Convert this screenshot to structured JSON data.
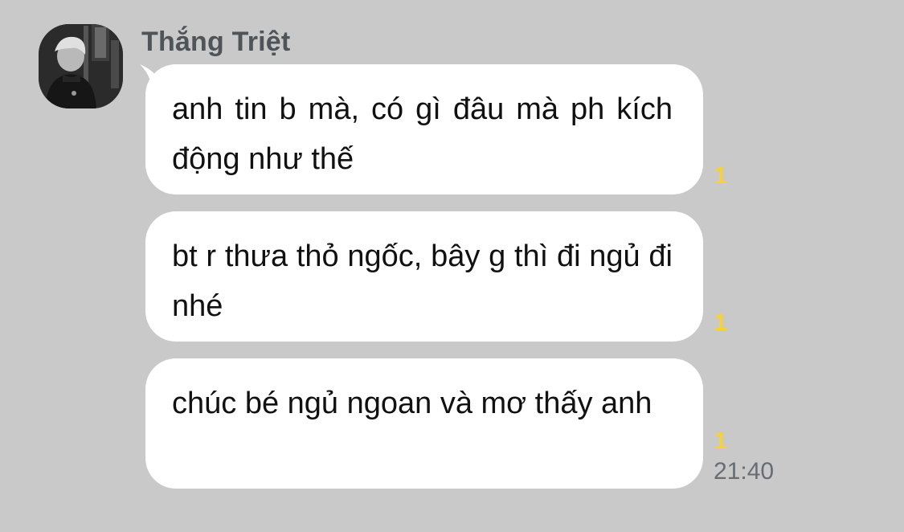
{
  "chat": {
    "sender": {
      "name": "Thắng Triệt",
      "avatar_icon": "profile-photo"
    },
    "messages": [
      {
        "text": "anh tin b mà, có gì đâu mà ph kích động như thế",
        "unread": "1"
      },
      {
        "text": "bt r thưa thỏ ngốc, bây g thì đi ngủ đi nhé",
        "unread": "1"
      },
      {
        "text": "chúc bé ngủ ngoan và mơ thấy anh",
        "unread": "1",
        "time": "21:40"
      }
    ]
  },
  "colors": {
    "background": "#c9c9c9",
    "bubble": "#ffffff",
    "unread_badge": "#f4d13d",
    "sender_name": "#4f5458",
    "timestamp": "#676d72"
  }
}
